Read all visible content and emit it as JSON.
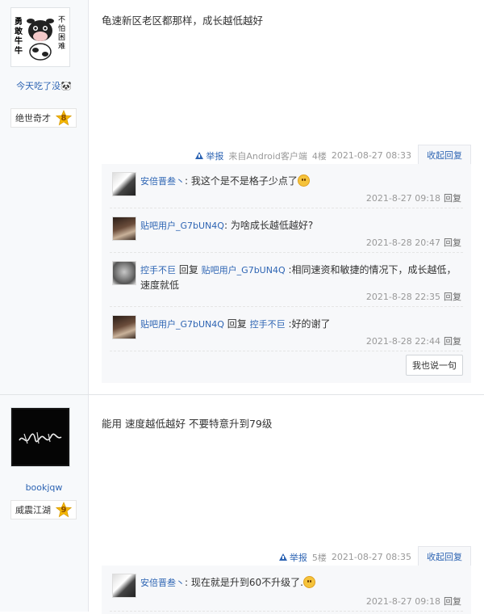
{
  "posts": [
    {
      "avatar_text": {
        "left": "勇敢牛牛",
        "right": "不怕困难"
      },
      "username": "今天吃了没🐼",
      "level_name": "绝世奇才",
      "level_num": "8",
      "content": "龟速新区老区都那样，成长越低越好",
      "tail": {
        "report": "举报",
        "source": "来自Android客户端",
        "floor": "4楼",
        "time": "2021-08-27 08:33",
        "reply_toggle": "收起回复"
      },
      "comments": [
        {
          "user": "安倍晋叁丶",
          "sep": ":",
          "text": "我这个是不是格子少点了",
          "time": "2021-8-27 09:18",
          "reply": "回复"
        },
        {
          "user": "贴吧用户_G7bUN4Q",
          "sep": ":",
          "text": "为啥成长越低越好?",
          "time": "2021-8-28 20:47",
          "reply": "回复"
        },
        {
          "user": "控手不巨",
          "prefix": "回复",
          "target": "贴吧用户_G7bUN4Q",
          "sep": " :",
          "text": "相同速资和敏捷的情况下，成长越低，速度就低",
          "time": "2021-8-28 22:35",
          "reply": "回复"
        },
        {
          "user": "贴吧用户_G7bUN4Q",
          "prefix": "回复",
          "target": "控手不巨",
          "sep": " :",
          "text": "好的谢了",
          "time": "2021-8-28 22:44",
          "reply": "回复"
        }
      ],
      "say_button": "我也说一句"
    },
    {
      "username": "bookjqw",
      "level_name": "威震江湖",
      "level_num": "9",
      "content": "能用 速度越低越好 不要特意升到79级",
      "tail": {
        "report": "举报",
        "floor": "5楼",
        "time": "2021-08-27 08:35",
        "reply_toggle": "收起回复"
      },
      "comments": [
        {
          "user": "安倍晋叁丶",
          "sep": ":",
          "text": "现在就是升到60不升级了.",
          "time": "2021-8-27 09:18",
          "reply": "回复"
        }
      ]
    }
  ],
  "colors": {
    "link": "#2d64b3",
    "meta": "#999999",
    "sidebar": "#f7f9fb",
    "star": "#f5b800"
  }
}
